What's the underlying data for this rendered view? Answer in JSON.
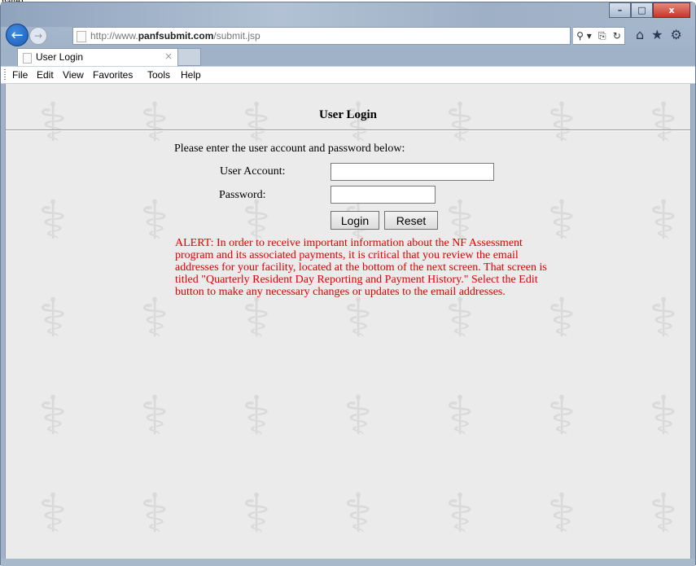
{
  "browser": {
    "top_strip_text": "page).",
    "window_buttons": {
      "minimize": "–",
      "maximize": "□",
      "close": "x"
    },
    "back_icon": "back-arrow-icon",
    "forward_icon": "forward-arrow-icon",
    "url_prefix": "http://www.",
    "url_domain": "panfsubmit.com",
    "url_path": "/submit.jsp",
    "address_tools": {
      "search": "⚲ ▾",
      "compat": "⎘",
      "refresh": "↻"
    },
    "right_icons": {
      "home": "⌂",
      "favorites": "★",
      "settings": "⚙"
    },
    "tab_label": "User Login",
    "tab_close": "×"
  },
  "menu": {
    "items": [
      "File",
      "Edit",
      "View",
      "Favorites",
      "Tools",
      "Help"
    ]
  },
  "page": {
    "title": "User Login",
    "intro": "Please enter the user account and password below:",
    "account_label": "User Account:",
    "account_value": "",
    "password_label": "Password:",
    "password_value": "",
    "login_label": "Login",
    "reset_label": "Reset",
    "alert": "ALERT: In order to receive important information about the NF Assessment program and its associated payments, it is critical that you review the email addresses for your facility, located at the bottom of the next screen. That screen is titled \"Quarterly Resident Day Reporting and Payment History.\" Select the Edit button to make any necessary changes or updates to the email addresses.",
    "alert_color": "#e00000",
    "background_icon": "caduceus-icon"
  }
}
